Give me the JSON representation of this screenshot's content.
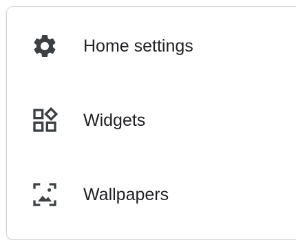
{
  "menu": {
    "items": [
      {
        "label": "Home settings",
        "icon": "gear-icon"
      },
      {
        "label": "Widgets",
        "icon": "widgets-icon"
      },
      {
        "label": "Wallpapers",
        "icon": "wallpaper-icon"
      }
    ]
  },
  "colors": {
    "text": "#202124",
    "icon": "#3c4043",
    "border": "#d8d8d8",
    "background": "#ffffff"
  }
}
